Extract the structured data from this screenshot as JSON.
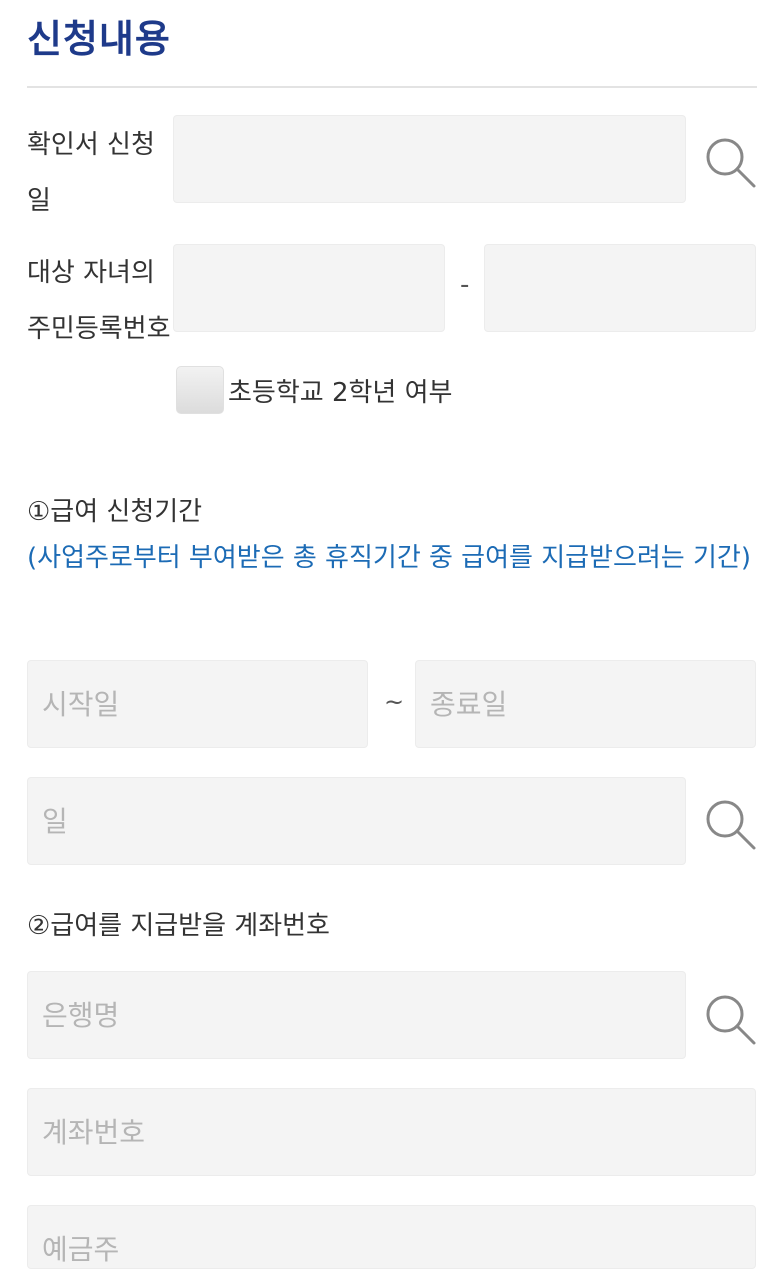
{
  "section": {
    "title": "신청내용"
  },
  "form": {
    "confirm_date_label": "확인서 신청일",
    "child_rrn_label": "대상 자녀의 주민등록번호",
    "rrn_separator": "-",
    "second_grade_label": "초등학교 2학년 여부",
    "period_label": "①급여 신청기간",
    "period_note": "(사업주로부터 부여받은 총 휴직기간 중 급여를 지급받으려는 기간)",
    "start_placeholder": "시작일",
    "period_separator": "~",
    "end_placeholder": "종료일",
    "days_placeholder": "일",
    "account_label": "②급여를 지급받을 계좌번호",
    "bank_placeholder": "은행명",
    "account_placeholder": "계좌번호",
    "holder_placeholder": "예금주"
  },
  "colors": {
    "title": "#1e3a8a",
    "note": "#1c6bb5",
    "field_bg": "#f4f4f4"
  }
}
